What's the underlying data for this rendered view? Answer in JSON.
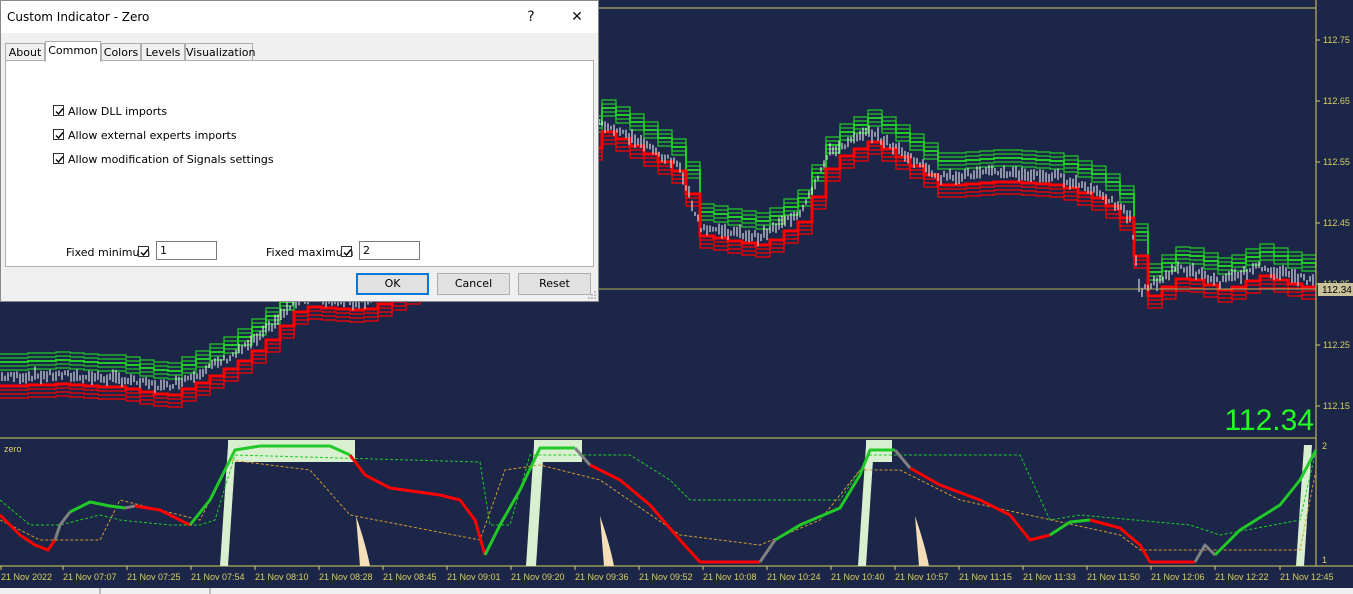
{
  "dialog": {
    "title": "Custom Indicator - Zero",
    "help_glyph": "?",
    "close_glyph": "✕",
    "tabs": [
      "About",
      "Common",
      "Colors",
      "Levels",
      "Visualization"
    ],
    "active_tab": "Common",
    "checkboxes": [
      {
        "label": "Allow DLL imports",
        "checked": true
      },
      {
        "label": "Allow external experts imports",
        "checked": true
      },
      {
        "label": "Allow modification of Signals settings",
        "checked": true
      }
    ],
    "fixed_minimum": {
      "label": "Fixed minimum",
      "checked": true,
      "value": "1"
    },
    "fixed_maximum": {
      "label": "Fixed maximum",
      "checked": true,
      "value": "2"
    },
    "buttons": {
      "ok": "OK",
      "cancel": "Cancel",
      "reset": "Reset"
    }
  },
  "chart": {
    "price_scale": [
      "112.75",
      "112.65",
      "112.55",
      "112.45",
      "112.35",
      "112.25",
      "112.15"
    ],
    "current_price_tag": "112.34",
    "big_price": "112.34",
    "indicator_name": "zero",
    "indicator_scale": [
      "2",
      "1"
    ],
    "time_labels": [
      "21 Nov 2022",
      "21 Nov 07:07",
      "21 Nov 07:25",
      "21 Nov 07:54",
      "21 Nov 08:10",
      "21 Nov 08:28",
      "21 Nov 08:45",
      "21 Nov 09:01",
      "21 Nov 09:20",
      "21 Nov 09:36",
      "21 Nov 09:52",
      "21 Nov 10:08",
      "21 Nov 10:24",
      "21 Nov 10:40",
      "21 Nov 10:57",
      "21 Nov 11:15",
      "21 Nov 11:33",
      "21 Nov 11:50",
      "21 Nov 12:06",
      "21 Nov 12:22",
      "21 Nov 12:45"
    ],
    "colors": {
      "background": "#1b2648",
      "bull": "#22c928",
      "bear": "#ff0000",
      "neutral": "#808080",
      "axis_text": "#d8d060",
      "big_price": "#22ff22"
    }
  }
}
